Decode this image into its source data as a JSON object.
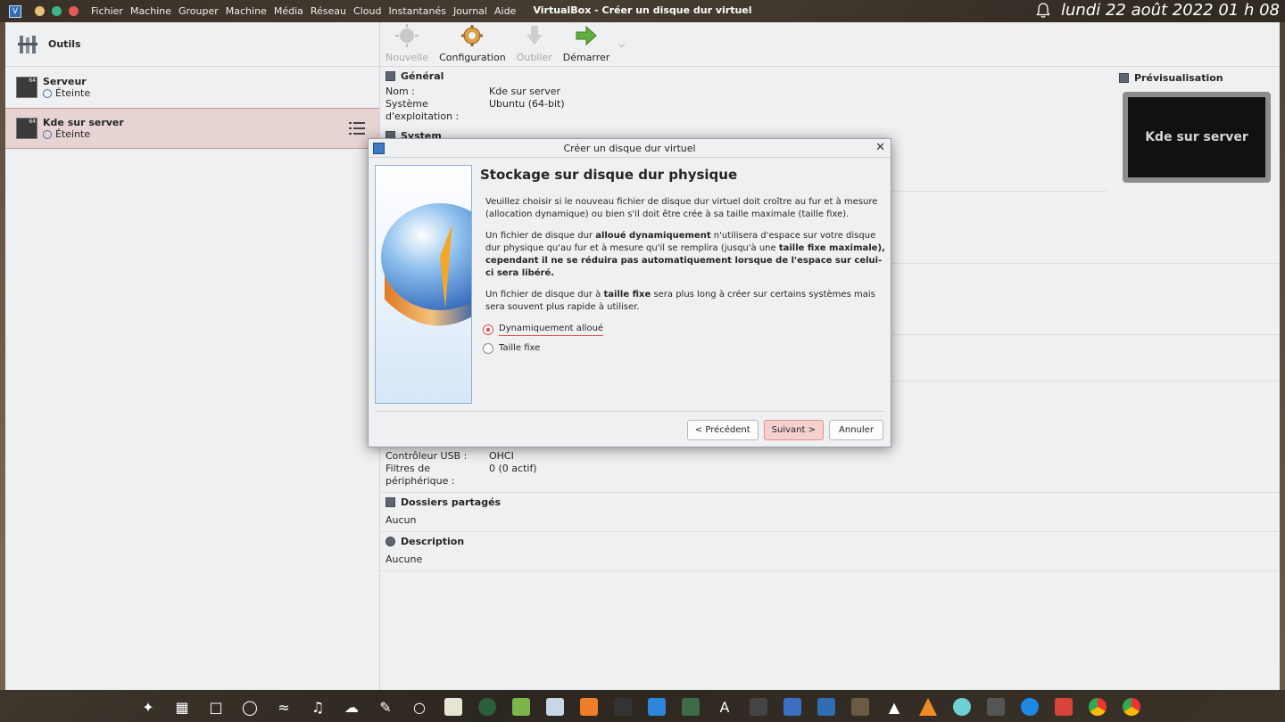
{
  "menubar": {
    "items": [
      "Fichier",
      "Machine",
      "Grouper",
      "Machine",
      "Média",
      "Réseau",
      "Cloud",
      "Instantanés",
      "Journal",
      "Aide"
    ],
    "window_title": "VirtualBox - Créer un disque dur virtuel",
    "clock": "lundi 22 août 2022  01 h 08"
  },
  "left_pane": {
    "tools_label": "Outils",
    "vms": [
      {
        "name": "Serveur",
        "state": "Éteinte"
      },
      {
        "name": "Kde sur server",
        "state": "Éteinte"
      }
    ]
  },
  "toolbar": {
    "new_label": "Nouvelle",
    "settings_label": "Configuration",
    "discard_label": "Oublier",
    "start_label": "Démarrer"
  },
  "details": {
    "general_title": "Général",
    "name_key": "Nom :",
    "name_value": "Kde sur server",
    "os_key": "Système d'exploitation :",
    "os_value": "Ubuntu (64-bit)",
    "system_title": "System",
    "usb_key": "Contrôleur USB :",
    "usb_value": "OHCI",
    "filters_key": "Filtres de périphérique :",
    "filters_value": "0 (0 actif)",
    "shared_title": "Dossiers partagés",
    "shared_value": "Aucun",
    "desc_title": "Description",
    "desc_value": "Aucune"
  },
  "preview": {
    "title": "Prévisualisation",
    "screen_text": "Kde sur server"
  },
  "dialog": {
    "title": "Créer un disque dur virtuel",
    "heading": "Stockage sur disque dur physique",
    "p1": "Veuillez choisir si le nouveau fichier de disque dur virtuel doit croître au fur et à mesure (allocation dynamique) ou bien s'il doit être crée à sa taille maximale (taille fixe).",
    "p2_a": "Un fichier de disque dur ",
    "p2_b": "alloué dynamiquement",
    "p2_c": " n'utilisera d'espace sur votre disque dur physique qu'au fur et à mesure qu'il se remplira (jusqu'à une ",
    "p2_d": "taille fixe maximale), cependant il ne se réduira pas automatiquement lorsque de l'espace sur celui-ci sera libéré.",
    "p3_a": "Un fichier de disque dur à ",
    "p3_b": "taille fixe",
    "p3_c": " sera plus long à créer sur certains systèmes mais sera souvent plus rapide à utiliser.",
    "option_dynamic": "Dynamiquement alloué",
    "option_fixed": "Taille fixe",
    "btn_back": "< Précédent",
    "btn_next": "Suivant >",
    "btn_cancel": "Annuler"
  },
  "colors": {
    "accent": "#e24b4b",
    "selection": "#e8d3d3",
    "window_bg": "#eff0f1"
  }
}
